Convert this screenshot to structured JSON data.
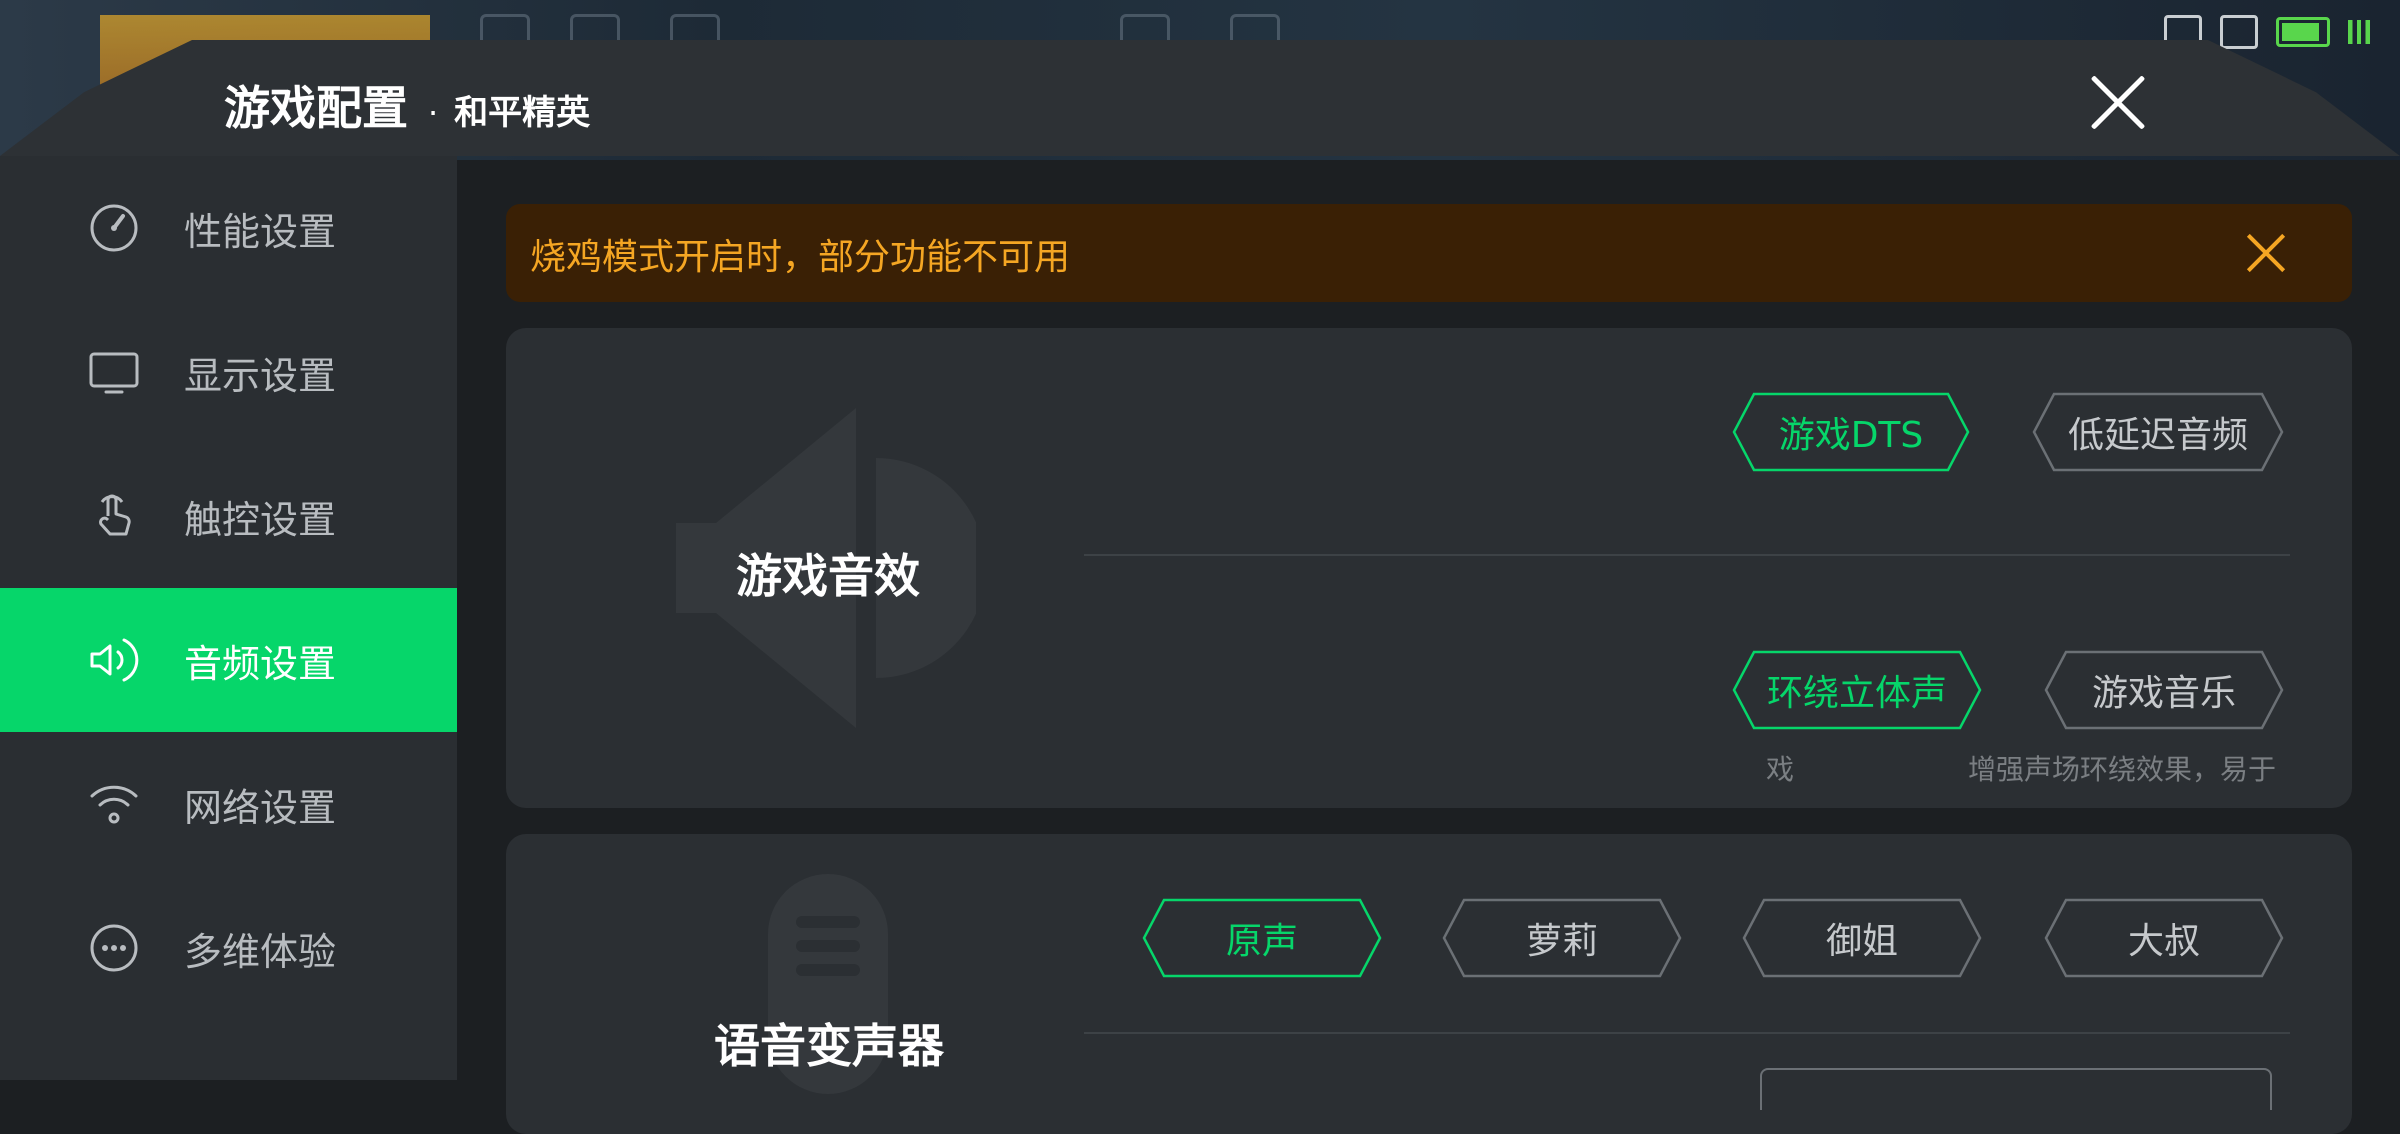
{
  "header": {
    "title": "游戏配置",
    "separator": "·",
    "subtitle": "和平精英"
  },
  "sidebar": {
    "items": [
      {
        "label": "性能设置",
        "icon": "speedometer-icon",
        "active": false
      },
      {
        "label": "显示设置",
        "icon": "monitor-icon",
        "active": false
      },
      {
        "label": "触控设置",
        "icon": "touch-hand-icon",
        "active": false
      },
      {
        "label": "音频设置",
        "icon": "speaker-icon",
        "active": true
      },
      {
        "label": "网络设置",
        "icon": "wifi-icon",
        "active": false
      },
      {
        "label": "多维体验",
        "icon": "more-dots-icon",
        "active": false
      }
    ]
  },
  "notice": {
    "text": "烧鸡模式开启时，部分功能不可用"
  },
  "game_sound": {
    "label": "游戏音效",
    "row1": [
      "游戏DTS",
      "低延迟音频"
    ],
    "row2": [
      "环绕立体声",
      "游戏音乐"
    ],
    "selected": [
      "游戏DTS",
      "环绕立体声"
    ],
    "hint_left": "戏",
    "hint_right": "增强声场环绕效果，易于"
  },
  "voice_changer": {
    "label": "语音变声器",
    "options": [
      "原声",
      "萝莉",
      "御姐",
      "大叔"
    ],
    "selected": "原声"
  },
  "colors": {
    "accent": "#06d66a",
    "warning": "#f5a623",
    "warning_bg": "#3a2005",
    "panel": "#2b2f33"
  }
}
